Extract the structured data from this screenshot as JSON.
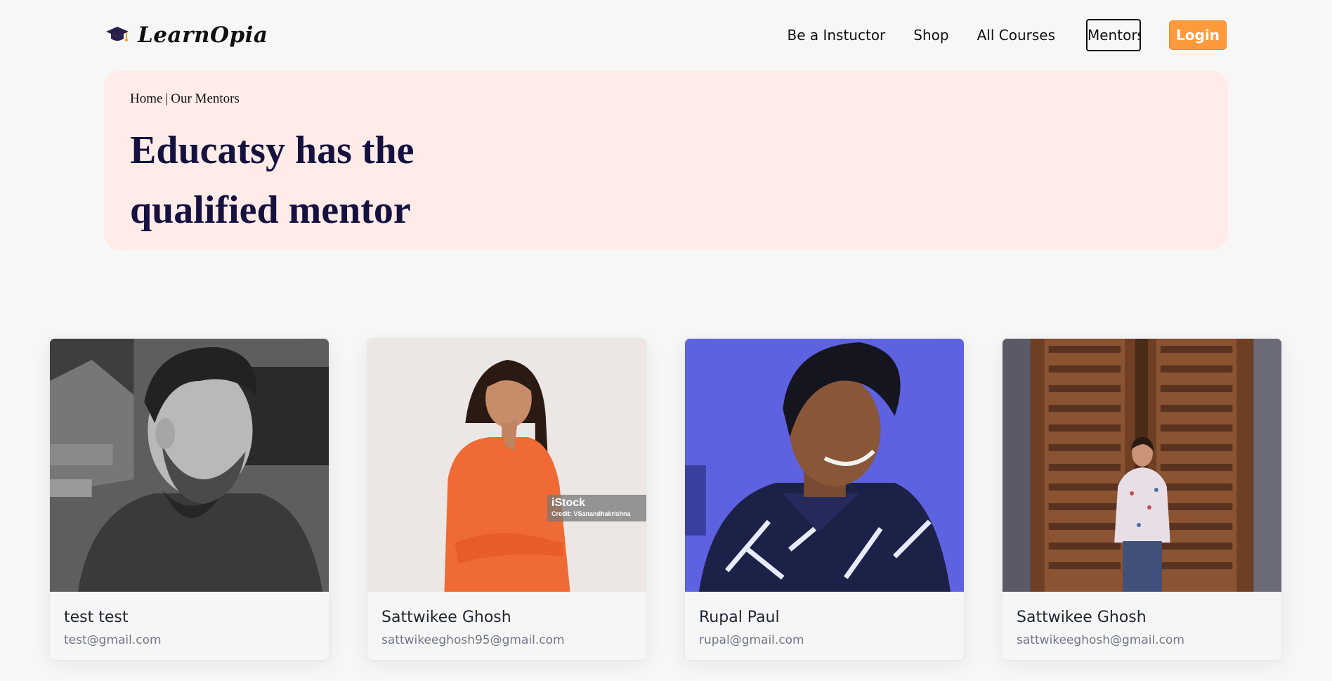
{
  "brand": {
    "name": "LearnOpia",
    "icon": "graduation-cap-icon"
  },
  "nav": {
    "links": [
      "Be a Instuctor",
      "Shop",
      "All Courses",
      "Mentors"
    ],
    "active": "Mentors",
    "login_label": "Login"
  },
  "hero": {
    "breadcrumb": {
      "home": "Home",
      "separator": "|",
      "current": "Our Mentors"
    },
    "title": "Educatsy has the qualified mentor"
  },
  "mentors": [
    {
      "name": "test test",
      "email": "test@gmail.com"
    },
    {
      "name": "Sattwikee Ghosh",
      "email": "sattwikeeghosh95@gmail.com",
      "watermark": {
        "logo": "iStock",
        "credit": "Credit: VSanandhakrishna"
      }
    },
    {
      "name": "Rupal Paul",
      "email": "rupal@gmail.com"
    },
    {
      "name": "Sattwikee Ghosh",
      "email": "sattwikeeghosh@gmail.com"
    }
  ],
  "colors": {
    "accent": "#ff9a3c",
    "hero_bg": "#ffece9",
    "title": "#15113f",
    "page_bg": "#f7f7f7"
  }
}
